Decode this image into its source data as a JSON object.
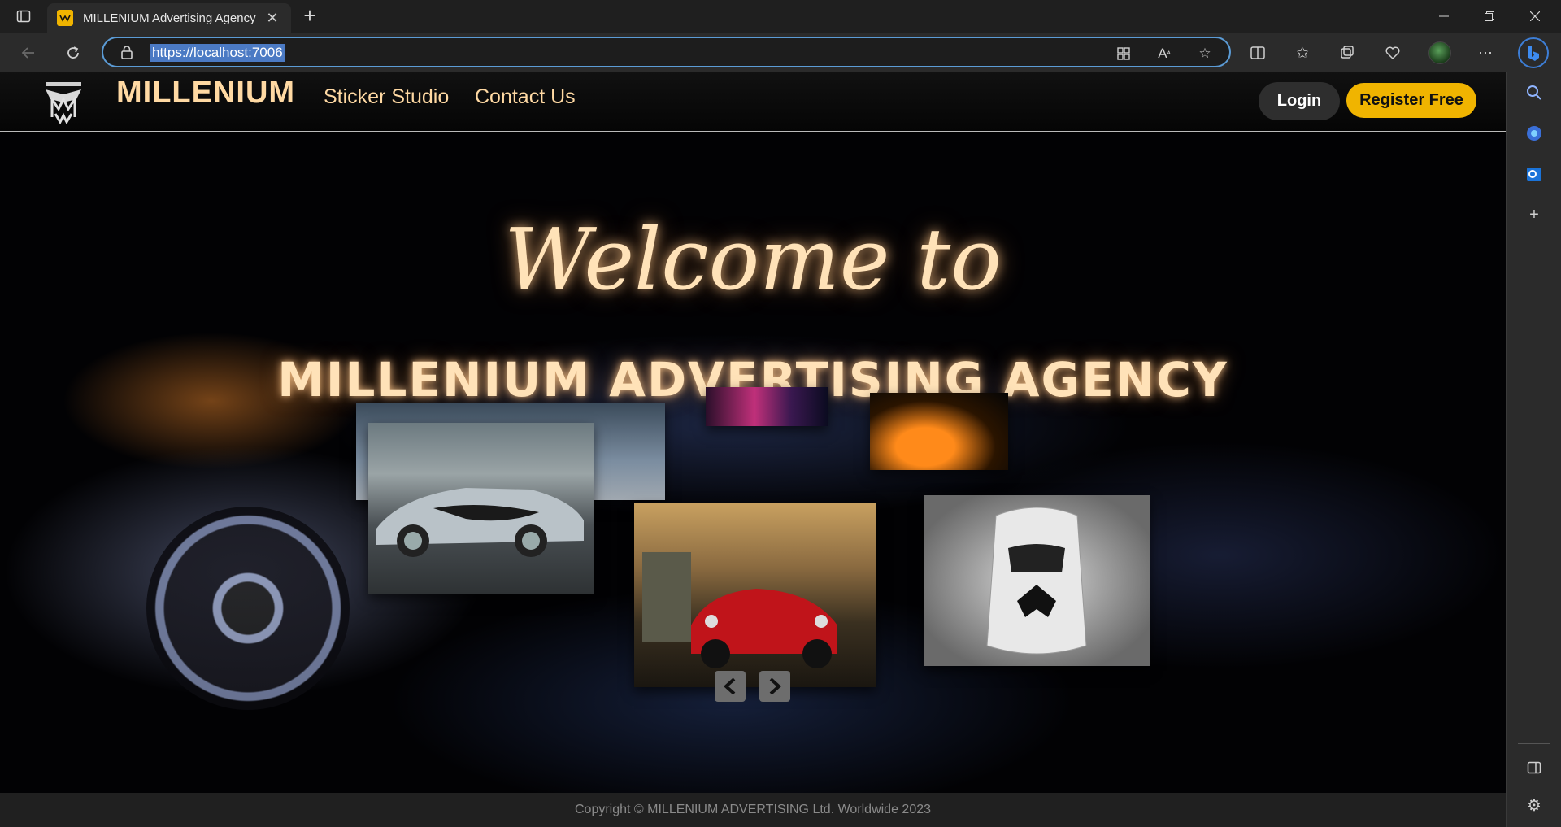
{
  "browser": {
    "tab_title": "MILLENIUM Advertising Agency",
    "url": "https://localhost:7006"
  },
  "site": {
    "brand": "MILLENIUM",
    "nav": [
      "Sticker Studio",
      "Contact Us"
    ],
    "login_label": "Login",
    "register_label": "Register Free"
  },
  "hero": {
    "welcome": "Welcome to",
    "title": "MILLENIUM ADVERTISING AGENCY"
  },
  "footer": {
    "copyright": "Copyright © MILLENIUM ADVERTISING Ltd. Worldwide 2023"
  },
  "colors": {
    "accent": "#f0b400",
    "brand_text": "#ffd9a3",
    "focus_ring": "#5b9bd5"
  }
}
